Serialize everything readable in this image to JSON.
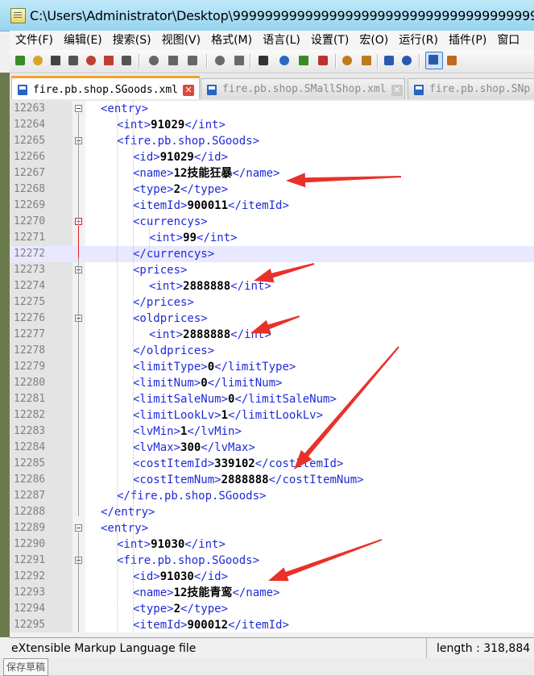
{
  "window": {
    "title": "C:\\Users\\Administrator\\Desktop\\999999999999999999999999999999999999999999999"
  },
  "menu": [
    "文件(F)",
    "编辑(E)",
    "搜索(S)",
    "视图(V)",
    "格式(M)",
    "语言(L)",
    "设置(T)",
    "宏(O)",
    "运行(R)",
    "插件(P)",
    "窗口"
  ],
  "toolbar": {
    "icons": [
      "new-file-icon",
      "open-file-icon",
      "save-icon",
      "save-all-icon",
      "close-icon",
      "close-all-icon",
      "print-icon",
      "cut-icon",
      "copy-icon",
      "paste-icon",
      "undo-icon",
      "redo-icon",
      "find-icon",
      "replace-icon",
      "zoom-in-icon",
      "zoom-out-icon",
      "sync-vertical-icon",
      "sync-horizontal-icon",
      "word-wrap-icon",
      "show-all-chars-icon",
      "indent-guide-icon",
      "user-language-icon"
    ]
  },
  "tabs": [
    {
      "label": "fire.pb.shop.SGoods.xml",
      "active": true
    },
    {
      "label": "fire.pb.shop.SMallShop.xml",
      "active": false
    },
    {
      "label": "fire.pb.shop.SNp",
      "active": false
    }
  ],
  "close_glyph": "✕",
  "editor": {
    "lines": [
      {
        "n": "12263",
        "indent": 1,
        "parts": [
          [
            "t",
            "<entry>"
          ]
        ],
        "fold": "box"
      },
      {
        "n": "12264",
        "indent": 2,
        "parts": [
          [
            "t",
            "<int>"
          ],
          [
            "v",
            "91029"
          ],
          [
            "t",
            "</int>"
          ]
        ]
      },
      {
        "n": "12265",
        "indent": 2,
        "parts": [
          [
            "t",
            "<fire.pb.shop.SGoods>"
          ]
        ],
        "fold": "box"
      },
      {
        "n": "12266",
        "indent": 3,
        "parts": [
          [
            "t",
            "<id>"
          ],
          [
            "v",
            "91029"
          ],
          [
            "t",
            "</id>"
          ]
        ]
      },
      {
        "n": "12267",
        "indent": 3,
        "parts": [
          [
            "t",
            "<name>"
          ],
          [
            "v",
            "12技能狂暴"
          ],
          [
            "t",
            "</name>"
          ]
        ]
      },
      {
        "n": "12268",
        "indent": 3,
        "parts": [
          [
            "t",
            "<type>"
          ],
          [
            "v",
            "2"
          ],
          [
            "t",
            "</type>"
          ]
        ]
      },
      {
        "n": "12269",
        "indent": 3,
        "parts": [
          [
            "t",
            "<itemId>"
          ],
          [
            "v",
            "900011"
          ],
          [
            "t",
            "</itemId>"
          ]
        ]
      },
      {
        "n": "12270",
        "indent": 3,
        "parts": [
          [
            "t",
            "<currencys>"
          ]
        ],
        "fold": "red"
      },
      {
        "n": "12271",
        "indent": 4,
        "parts": [
          [
            "t",
            "<int>"
          ],
          [
            "v",
            "99"
          ],
          [
            "t",
            "</int>"
          ]
        ]
      },
      {
        "n": "12272",
        "indent": 3,
        "parts": [
          [
            "t",
            "</currencys>"
          ]
        ],
        "current": true
      },
      {
        "n": "12273",
        "indent": 3,
        "parts": [
          [
            "t",
            "<prices>"
          ]
        ],
        "fold": "box"
      },
      {
        "n": "12274",
        "indent": 4,
        "parts": [
          [
            "t",
            "<int>"
          ],
          [
            "v",
            "2888888"
          ],
          [
            "t",
            "</int>"
          ]
        ]
      },
      {
        "n": "12275",
        "indent": 3,
        "parts": [
          [
            "t",
            "</prices>"
          ]
        ]
      },
      {
        "n": "12276",
        "indent": 3,
        "parts": [
          [
            "t",
            "<oldprices>"
          ]
        ],
        "fold": "box"
      },
      {
        "n": "12277",
        "indent": 4,
        "parts": [
          [
            "t",
            "<int>"
          ],
          [
            "v",
            "2888888"
          ],
          [
            "t",
            "</int>"
          ]
        ]
      },
      {
        "n": "12278",
        "indent": 3,
        "parts": [
          [
            "t",
            "</oldprices>"
          ]
        ]
      },
      {
        "n": "12279",
        "indent": 3,
        "parts": [
          [
            "t",
            "<limitType>"
          ],
          [
            "v",
            "0"
          ],
          [
            "t",
            "</limitType>"
          ]
        ]
      },
      {
        "n": "12280",
        "indent": 3,
        "parts": [
          [
            "t",
            "<limitNum>"
          ],
          [
            "v",
            "0"
          ],
          [
            "t",
            "</limitNum>"
          ]
        ]
      },
      {
        "n": "12281",
        "indent": 3,
        "parts": [
          [
            "t",
            "<limitSaleNum>"
          ],
          [
            "v",
            "0"
          ],
          [
            "t",
            "</limitSaleNum>"
          ]
        ]
      },
      {
        "n": "12282",
        "indent": 3,
        "parts": [
          [
            "t",
            "<limitLookLv>"
          ],
          [
            "v",
            "1"
          ],
          [
            "t",
            "</limitLookLv>"
          ]
        ]
      },
      {
        "n": "12283",
        "indent": 3,
        "parts": [
          [
            "t",
            "<lvMin>"
          ],
          [
            "v",
            "1"
          ],
          [
            "t",
            "</lvMin>"
          ]
        ]
      },
      {
        "n": "12284",
        "indent": 3,
        "parts": [
          [
            "t",
            "<lvMax>"
          ],
          [
            "v",
            "300"
          ],
          [
            "t",
            "</lvMax>"
          ]
        ]
      },
      {
        "n": "12285",
        "indent": 3,
        "parts": [
          [
            "t",
            "<costItemId>"
          ],
          [
            "v",
            "339102"
          ],
          [
            "t",
            "</costItemId>"
          ]
        ]
      },
      {
        "n": "12286",
        "indent": 3,
        "parts": [
          [
            "t",
            "<costItemNum>"
          ],
          [
            "v",
            "2888888"
          ],
          [
            "t",
            "</costItemNum>"
          ]
        ]
      },
      {
        "n": "12287",
        "indent": 2,
        "parts": [
          [
            "t",
            "</fire.pb.shop.SGoods>"
          ]
        ]
      },
      {
        "n": "12288",
        "indent": 1,
        "parts": [
          [
            "t",
            "</entry>"
          ]
        ]
      },
      {
        "n": "12289",
        "indent": 1,
        "parts": [
          [
            "t",
            "<entry>"
          ]
        ],
        "fold": "box"
      },
      {
        "n": "12290",
        "indent": 2,
        "parts": [
          [
            "t",
            "<int>"
          ],
          [
            "v",
            "91030"
          ],
          [
            "t",
            "</int>"
          ]
        ]
      },
      {
        "n": "12291",
        "indent": 2,
        "parts": [
          [
            "t",
            "<fire.pb.shop.SGoods>"
          ]
        ],
        "fold": "box"
      },
      {
        "n": "12292",
        "indent": 3,
        "parts": [
          [
            "t",
            "<id>"
          ],
          [
            "v",
            "91030"
          ],
          [
            "t",
            "</id>"
          ]
        ]
      },
      {
        "n": "12293",
        "indent": 3,
        "parts": [
          [
            "t",
            "<name>"
          ],
          [
            "v",
            "12技能青鸾"
          ],
          [
            "t",
            "</name>"
          ]
        ]
      },
      {
        "n": "12294",
        "indent": 3,
        "parts": [
          [
            "t",
            "<type>"
          ],
          [
            "v",
            "2"
          ],
          [
            "t",
            "</type>"
          ]
        ]
      },
      {
        "n": "12295",
        "indent": 3,
        "parts": [
          [
            "t",
            "<itemId>"
          ],
          [
            "v",
            "900012"
          ],
          [
            "t",
            "</itemId>"
          ]
        ]
      }
    ]
  },
  "status": {
    "file_type": "eXtensible Markup Language file",
    "length": "length : 318,884"
  },
  "below": {
    "ghost_label": "保存草稿"
  },
  "annotation_color": "#e8312a"
}
